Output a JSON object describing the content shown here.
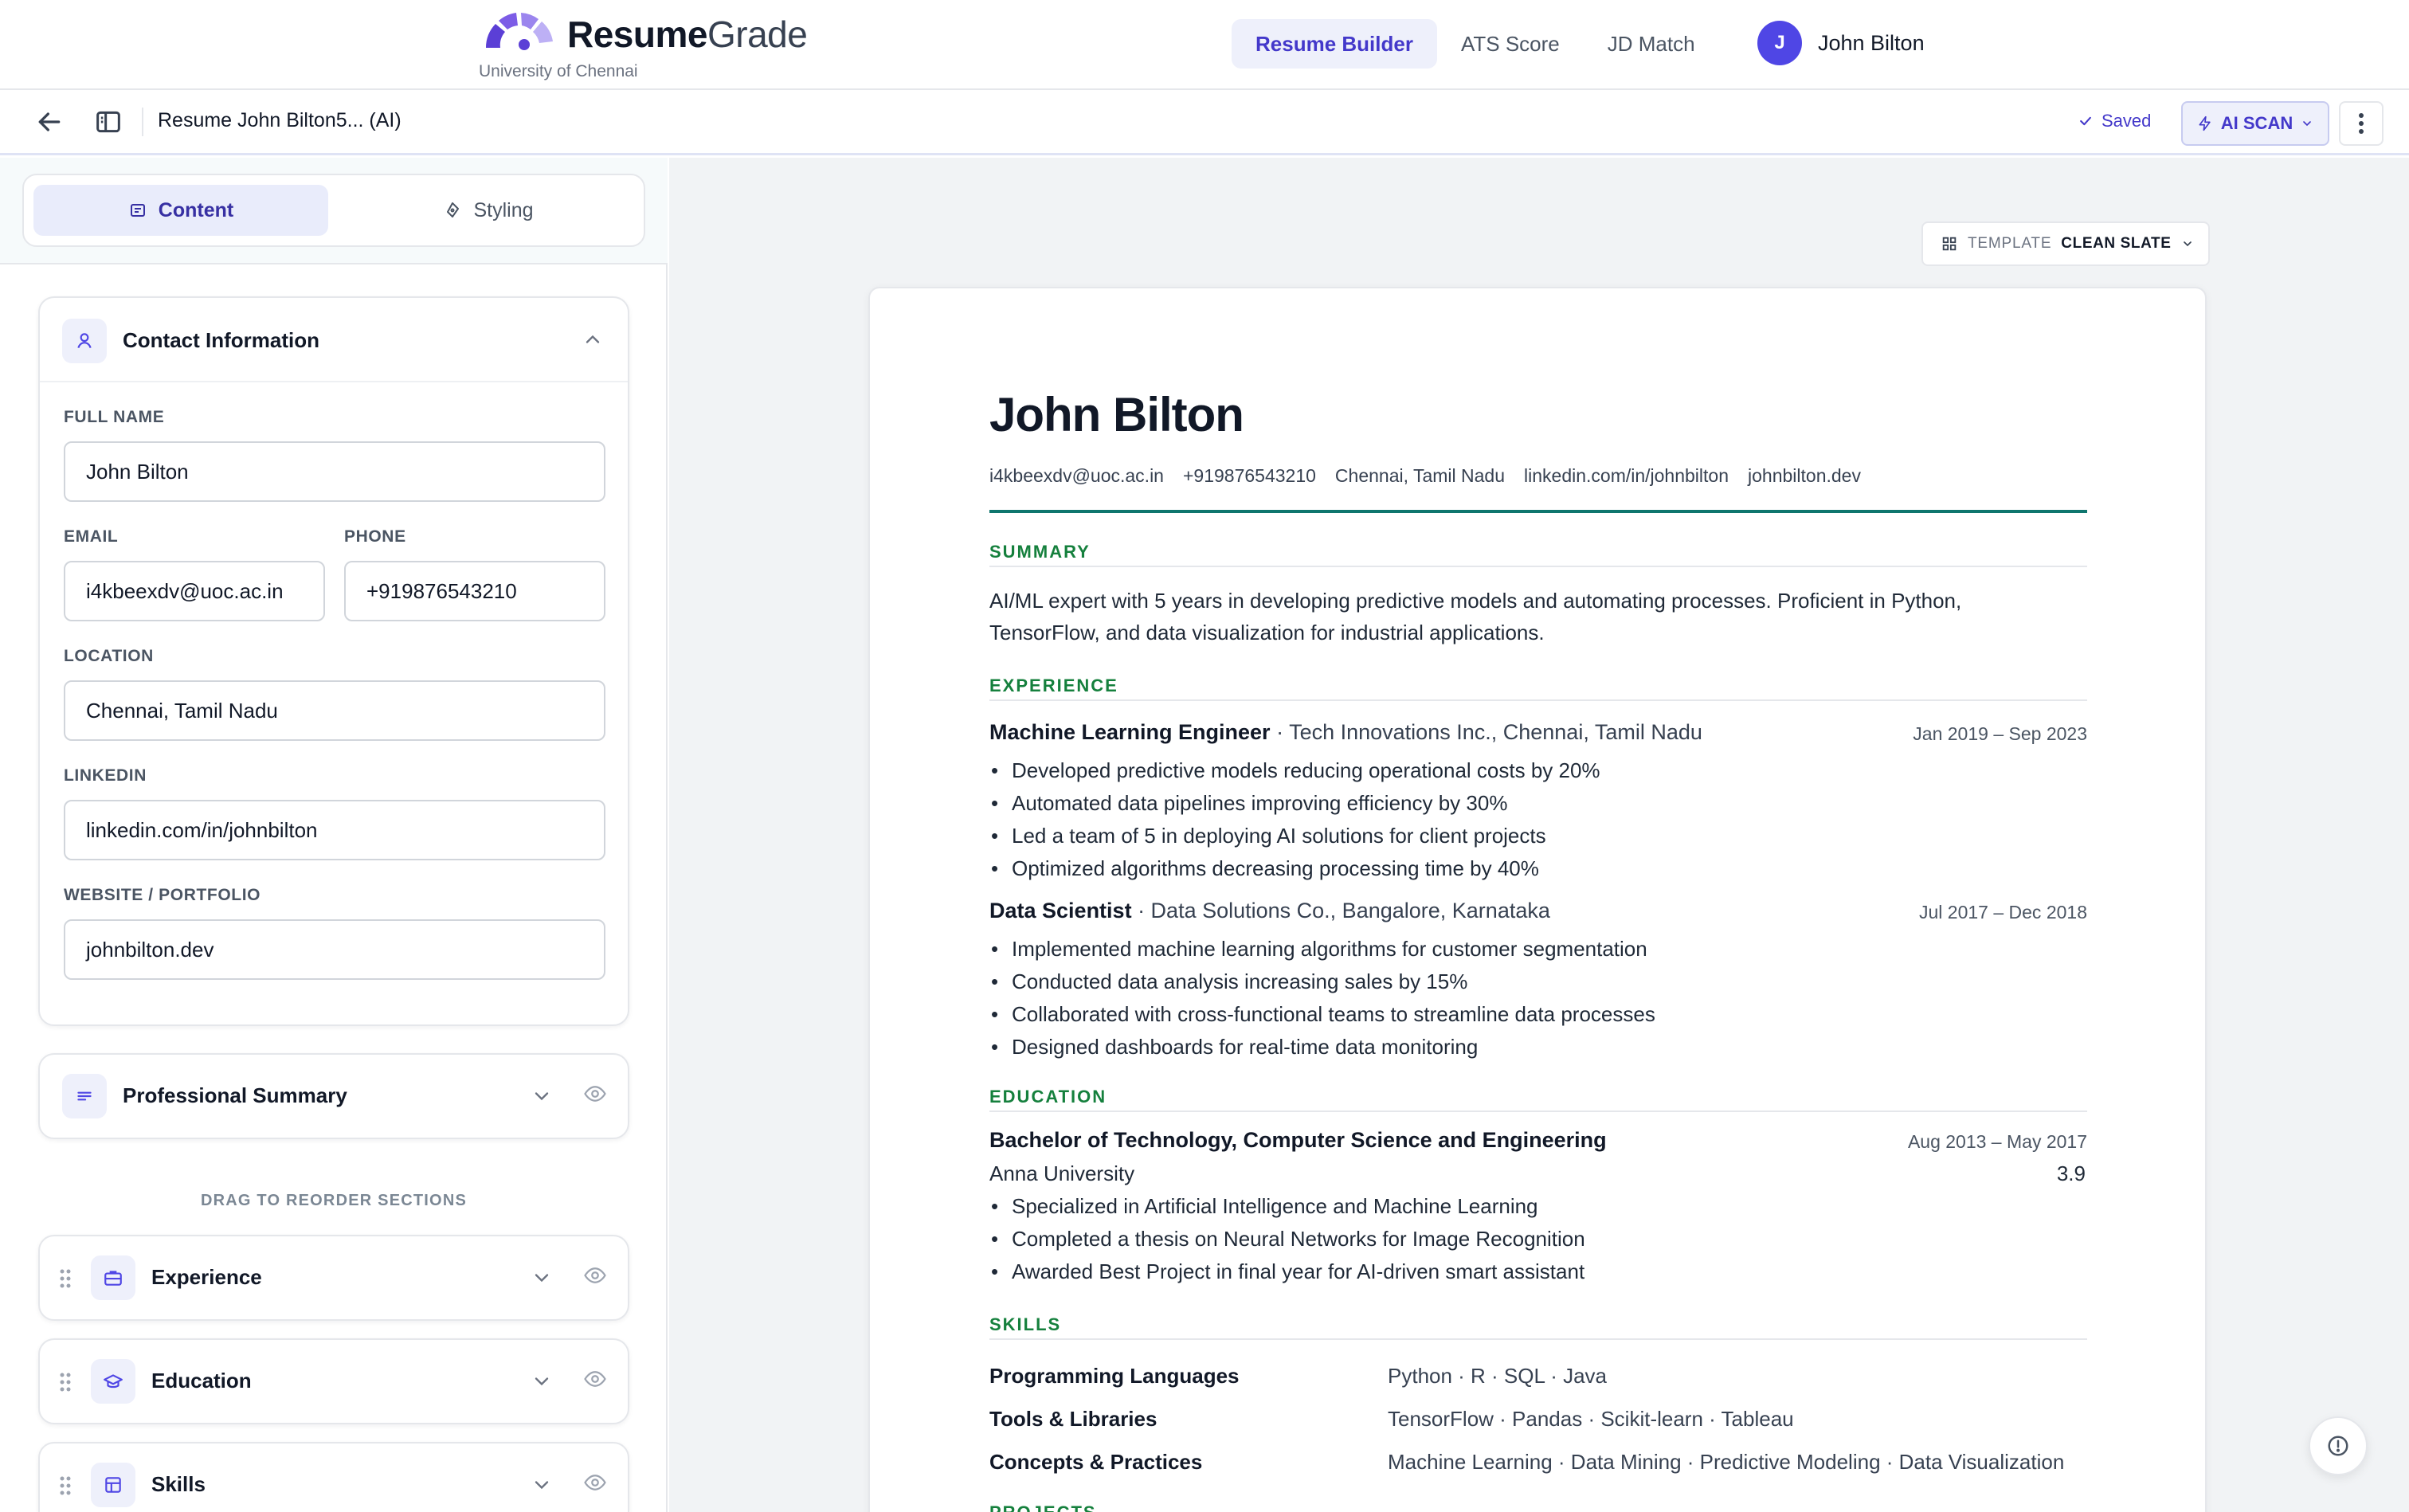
{
  "brand": {
    "name_bold": "Resume",
    "name_light": "Grade",
    "subtitle": "University of Chennai",
    "logo_icon": "semicircle-dots-logo"
  },
  "nav": {
    "tabs": [
      {
        "label": "Resume Builder",
        "active": true
      },
      {
        "label": "ATS Score",
        "active": false
      },
      {
        "label": "JD Match",
        "active": false
      }
    ],
    "user": {
      "initial": "J",
      "name": "John Bilton"
    }
  },
  "toolbar": {
    "back_icon": "arrow-left-icon",
    "panel_icon": "sidebar-panel-icon",
    "doc_title": "Resume John Bilton5... (AI)",
    "saved_label": "Saved",
    "ai_scan_label": "AI SCAN",
    "more_icon": "kebab-icon"
  },
  "editor": {
    "tabs": [
      {
        "label": "Content",
        "icon": "document-icon",
        "active": true
      },
      {
        "label": "Styling",
        "icon": "palette-icon",
        "active": false
      }
    ],
    "contact": {
      "title": "Contact Information",
      "fields": {
        "full_name": {
          "label": "FULL NAME",
          "value": "John Bilton"
        },
        "email": {
          "label": "EMAIL",
          "value": "i4kbeexdv@uoc.ac.in"
        },
        "phone": {
          "label": "PHONE",
          "value": "+919876543210"
        },
        "location": {
          "label": "LOCATION",
          "value": "Chennai, Tamil Nadu"
        },
        "linkedin": {
          "label": "LINKEDIN",
          "value": "linkedin.com/in/johnbilton"
        },
        "website": {
          "label": "WEBSITE / PORTFOLIO",
          "value": "johnbilton.dev"
        }
      }
    },
    "summary_section": {
      "title": "Professional Summary"
    },
    "drag_hint": "DRAG TO REORDER SECTIONS",
    "sections": [
      {
        "title": "Experience",
        "icon": "briefcase-icon"
      },
      {
        "title": "Education",
        "icon": "graduation-cap-icon"
      },
      {
        "title": "Skills",
        "icon": "grid-icon"
      }
    ]
  },
  "template": {
    "label": "TEMPLATE",
    "value": "CLEAN SLATE"
  },
  "resume": {
    "name": "John Bilton",
    "contacts": [
      "i4kbeexdv@uoc.ac.in",
      "+919876543210",
      "Chennai, Tamil Nadu",
      "linkedin.com/in/johnbilton",
      "johnbilton.dev"
    ],
    "summary_heading": "SUMMARY",
    "summary_text": "AI/ML expert with 5 years in developing predictive models and automating processes. Proficient in Python, TensorFlow, and data visualization for industrial applications.",
    "experience_heading": "EXPERIENCE",
    "jobs": [
      {
        "title": "Machine Learning Engineer",
        "company": " · Tech Innovations Inc., Chennai, Tamil Nadu",
        "dates": "Jan 2019 – Sep 2023",
        "bullets": [
          "Developed predictive models reducing operational costs by 20%",
          "Automated data pipelines improving efficiency by 30%",
          "Led a team of 5 in deploying AI solutions for client projects",
          "Optimized algorithms decreasing processing time by 40%"
        ]
      },
      {
        "title": "Data Scientist",
        "company": " · Data Solutions Co., Bangalore, Karnataka",
        "dates": "Jul 2017 – Dec 2018",
        "bullets": [
          "Implemented machine learning algorithms for customer segmentation",
          "Conducted data analysis increasing sales by 15%",
          "Collaborated with cross-functional teams to streamline data processes",
          "Designed dashboards for real-time data monitoring"
        ]
      }
    ],
    "education_heading": "EDUCATION",
    "education": {
      "degree": "Bachelor of Technology, Computer Science and Engineering",
      "dates": "Aug 2013 – May 2017",
      "school": "Anna University",
      "gpa": "3.9",
      "bullets": [
        "Specialized in Artificial Intelligence and Machine Learning",
        "Completed a thesis on Neural Networks for Image Recognition",
        "Awarded Best Project in final year for AI-driven smart assistant"
      ]
    },
    "skills_heading": "SKILLS",
    "skills": [
      {
        "category": "Programming Languages",
        "items": "Python · R · SQL · Java"
      },
      {
        "category": "Tools & Libraries",
        "items": "TensorFlow · Pandas · Scikit-learn · Tableau"
      },
      {
        "category": "Concepts & Practices",
        "items": "Machine Learning · Data Mining · Predictive Modeling · Data Visualization"
      }
    ],
    "projects_heading": "PROJECTS"
  },
  "help_icon": "help-circle-icon",
  "colors": {
    "accent": "#4f46e5",
    "section_heading": "#15803d",
    "rule": "#0f766e"
  }
}
